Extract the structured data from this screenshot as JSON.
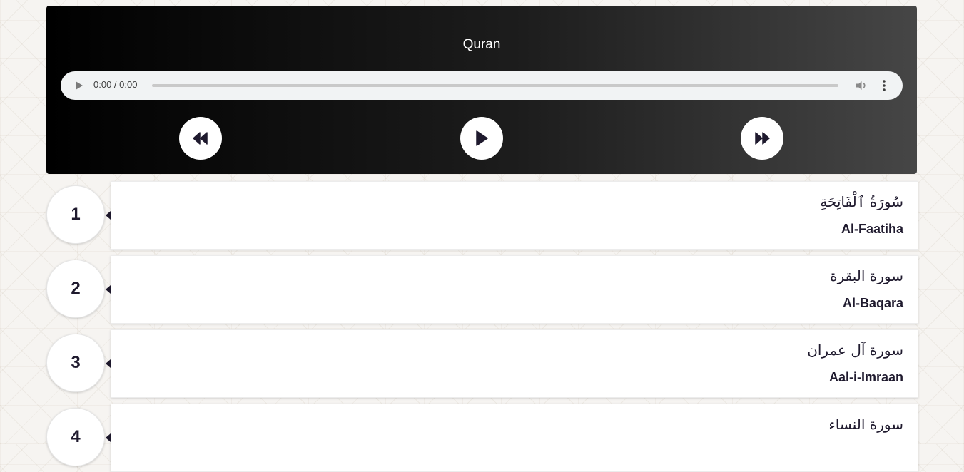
{
  "player": {
    "title": "Quran",
    "time_display": "0:00 / 0:00",
    "controls": [
      {
        "name": "previous-button",
        "icon": "rewind-icon"
      },
      {
        "name": "play-button",
        "icon": "play-icon"
      },
      {
        "name": "next-button",
        "icon": "fast-forward-icon"
      }
    ],
    "icon_color": "#1f1a2e"
  },
  "surahs": [
    {
      "number": "1",
      "arabic": "سُورَةُ ٱلْفَاتِحَةِ",
      "latin": "Al-Faatiha"
    },
    {
      "number": "2",
      "arabic": "سورة البقرة",
      "latin": "Al-Baqara"
    },
    {
      "number": "3",
      "arabic": "سورة آل عمران",
      "latin": "Aal-i-Imraan"
    },
    {
      "number": "4",
      "arabic": "سورة النساء",
      "latin": ""
    }
  ]
}
